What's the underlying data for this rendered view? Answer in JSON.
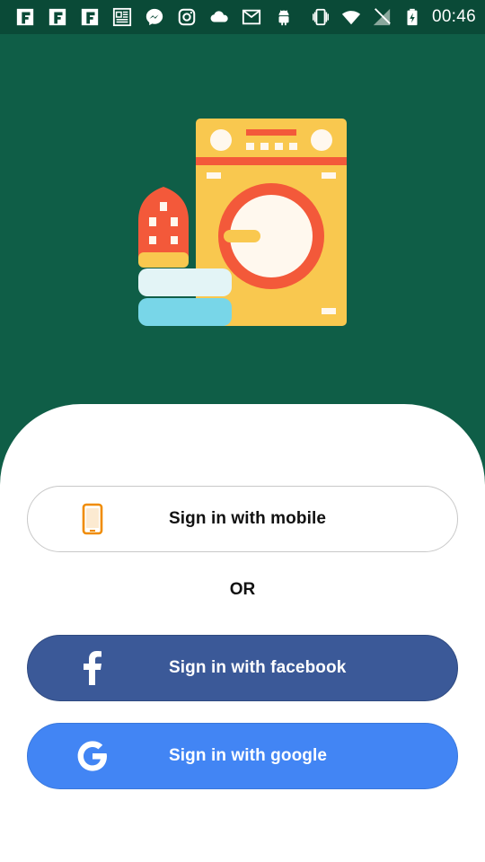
{
  "status_bar": {
    "time": "00:46",
    "icons_left": [
      "flipboard-icon",
      "flipboard-icon",
      "flipboard-icon",
      "news-icon",
      "messenger-icon",
      "instagram-icon",
      "cloud-icon",
      "gmail-icon",
      "android-icon"
    ],
    "icons_right": [
      "vibrate-icon",
      "wifi-icon",
      "no-signal-icon",
      "battery-charging-icon"
    ]
  },
  "colors": {
    "background": "#0f5e47",
    "status_bar": "#0a4a37",
    "facebook": "#3b5998",
    "google": "#4285f4",
    "mobile_icon": "#f08c00"
  },
  "auth": {
    "mobile_label": "Sign in with mobile",
    "or_label": "OR",
    "facebook_label": "Sign in with facebook",
    "google_label": "Sign in with google"
  }
}
